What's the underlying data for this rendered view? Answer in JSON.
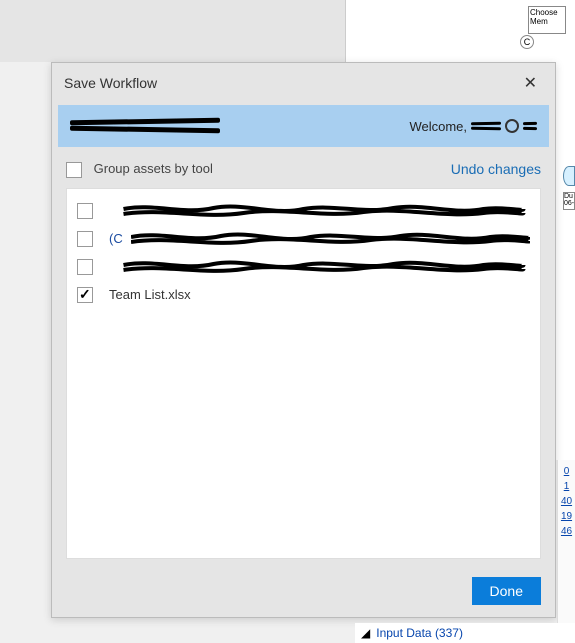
{
  "background": {
    "node1_label": "Choose Mem",
    "node2_label": "C",
    "partial_box_label": "Du 06-"
  },
  "dialog": {
    "title": "Save Workflow",
    "welcome_label": "Welcome,",
    "group_label": "Group assets by tool",
    "undo_label": "Undo changes",
    "items": [
      {
        "checked": false,
        "label": "",
        "redacted": true,
        "link": false
      },
      {
        "checked": false,
        "label": "(C",
        "redacted": true,
        "link": true
      },
      {
        "checked": false,
        "label": "",
        "redacted": true,
        "link": false
      },
      {
        "checked": true,
        "label": "Team List.xlsx",
        "redacted": false,
        "link": false
      }
    ],
    "done_label": "Done"
  },
  "bottom": {
    "input_data_label": "Input Data (337)"
  },
  "right_strip": {
    "v0": "0",
    "v1": "1",
    "v2": "40",
    "v3": "19",
    "v4": "46"
  }
}
